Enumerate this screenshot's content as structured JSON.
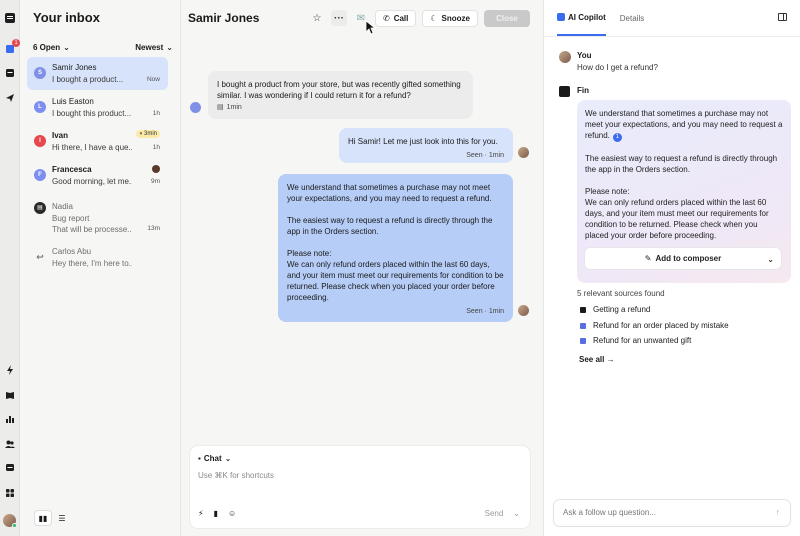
{
  "rail": {
    "badge_count": "1"
  },
  "inbox": {
    "title": "Your inbox",
    "filter_open": "6 Open",
    "filter_sort": "Newest",
    "conversations": [
      {
        "initial": "S",
        "name": "Samir Jones",
        "preview": "I bought a product...",
        "time": "Now",
        "color": "#8090e6"
      },
      {
        "initial": "L",
        "name": "Luis Easton",
        "preview": "I bought this product...",
        "time": "1h",
        "color": "#7d8ef0"
      },
      {
        "initial": "I",
        "name": "Ivan",
        "preview": "Hi there, I have a que...",
        "time": "1h",
        "tag": "3min",
        "color": "#e5484d"
      },
      {
        "initial": "F",
        "name": "Francesca",
        "preview": "Good morning, let me...",
        "time": "9m",
        "color": "#7d8ef0"
      },
      {
        "name": "Nadia",
        "preview": "Bug report",
        "preview2": "That will be processe...",
        "time": "13m"
      },
      {
        "name": "Carlos Abu",
        "preview": "Hey there, I'm here to...",
        "time": ""
      }
    ]
  },
  "conversation": {
    "title": "Samir Jones",
    "actions": {
      "call": "Call",
      "snooze": "Snooze",
      "close": "Close"
    },
    "messages": {
      "m1": {
        "text": "I bought a product from your store, but was recently gifted something similar. I was wondering if I could return it for a refund?",
        "meta": "1min"
      },
      "m2": {
        "text": "Hi Samir! Let me just look into this for you.",
        "meta": "Seen · 1min"
      },
      "m3": {
        "p1": "We understand that sometimes a purchase may not meet your expectations, and you may need to request a refund.",
        "p2": "The easiest way to request a refund is directly through the app in the Orders section.",
        "p3": "Please note:",
        "p4": "We can only refund orders placed within the last 60 days, and your item must meet our requirements for condition to be returned. Please check when you placed your order before proceeding.",
        "meta": "Seen · 1min"
      }
    },
    "composer": {
      "mode": "Chat",
      "placeholder": "Use ⌘K for shortcuts",
      "send": "Send"
    }
  },
  "copilot": {
    "tab_active": "AI Copilot",
    "tab_other": "Details",
    "you_name": "You",
    "you_question": "How do I get a refund?",
    "fin_name": "Fin",
    "answer": {
      "p1": "We understand that sometimes a purchase may not meet your expectations, and you may need to request a refund.",
      "cite": "1",
      "p2": "The easiest way to request a refund is directly through the app in the Orders section.",
      "p3": "Please note:",
      "p4": "We can only refund orders placed within the last 60 days, and your item must meet our requirements for condition to be returned. Please check when you placed your order before proceeding."
    },
    "add_to_composer": "Add to composer",
    "sources_heading": "5 relevant sources found",
    "sources": [
      "Getting a refund",
      "Refund for an order placed by mistake",
      "Refund for an unwanted gift"
    ],
    "see_all": "See all →",
    "followup_placeholder": "Ask a follow up question..."
  }
}
